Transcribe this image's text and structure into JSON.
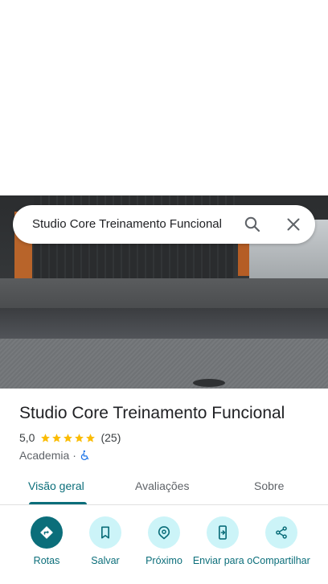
{
  "search": {
    "query": "Studio Core Treinamento Funcional"
  },
  "place": {
    "title": "Studio Core Treinamento Funcional",
    "rating": "5,0",
    "rating_value": 5.0,
    "reviews": "(25)",
    "category": "Academia",
    "separator": "·"
  },
  "tabs": [
    {
      "label": "Visão geral",
      "active": true
    },
    {
      "label": "Avaliações",
      "active": false
    },
    {
      "label": "Sobre",
      "active": false
    }
  ],
  "actions": [
    {
      "label": "Rotas",
      "icon": "directions-icon"
    },
    {
      "label": "Salvar",
      "icon": "bookmark-icon"
    },
    {
      "label": "Próximo",
      "icon": "nearby-icon"
    },
    {
      "label": "Enviar para o",
      "icon": "send-to-phone-icon"
    },
    {
      "label": "Compartilhar",
      "icon": "share-icon"
    }
  ],
  "colors": {
    "accent": "#0b6e7a",
    "action_bg": "#ccf4f8",
    "star": "#fbbc04",
    "accessibility": "#1a73e8"
  }
}
